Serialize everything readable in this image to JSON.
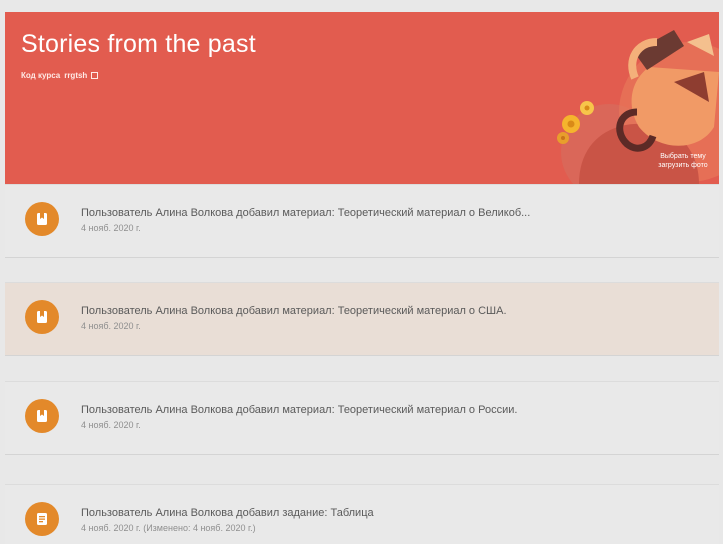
{
  "header": {
    "course_title": "Stories from the past",
    "course_code_label": "Код курса",
    "course_code_value": "rrgtsh",
    "photo_link_line1": "Выбрать тему",
    "photo_link_line2": "загрузить фото",
    "banner_color": "#e25c4f"
  },
  "stream": {
    "items": [
      {
        "title": "Пользователь Алина Волкова добавил материал: Теоретический материал о Великоб...",
        "date": "4 нояб. 2020 г.",
        "icon": "material-icon"
      },
      {
        "title": "Пользователь Алина Волкова добавил материал: Теоретический материал о США.",
        "date": "4 нояб. 2020 г.",
        "icon": "material-icon"
      },
      {
        "title": "Пользователь Алина Волкова добавил материал: Теоретический материал о России.",
        "date": "4 нояб. 2020 г.",
        "icon": "material-icon"
      },
      {
        "title": "Пользователь Алина Волкова добавил задание: Таблица",
        "date": "4 нояб. 2020 г. (Изменено: 4 нояб. 2020 г.)",
        "icon": "assignment-icon"
      }
    ],
    "icon_color": "#e3892a",
    "highlight_color": "#e9ded6"
  }
}
